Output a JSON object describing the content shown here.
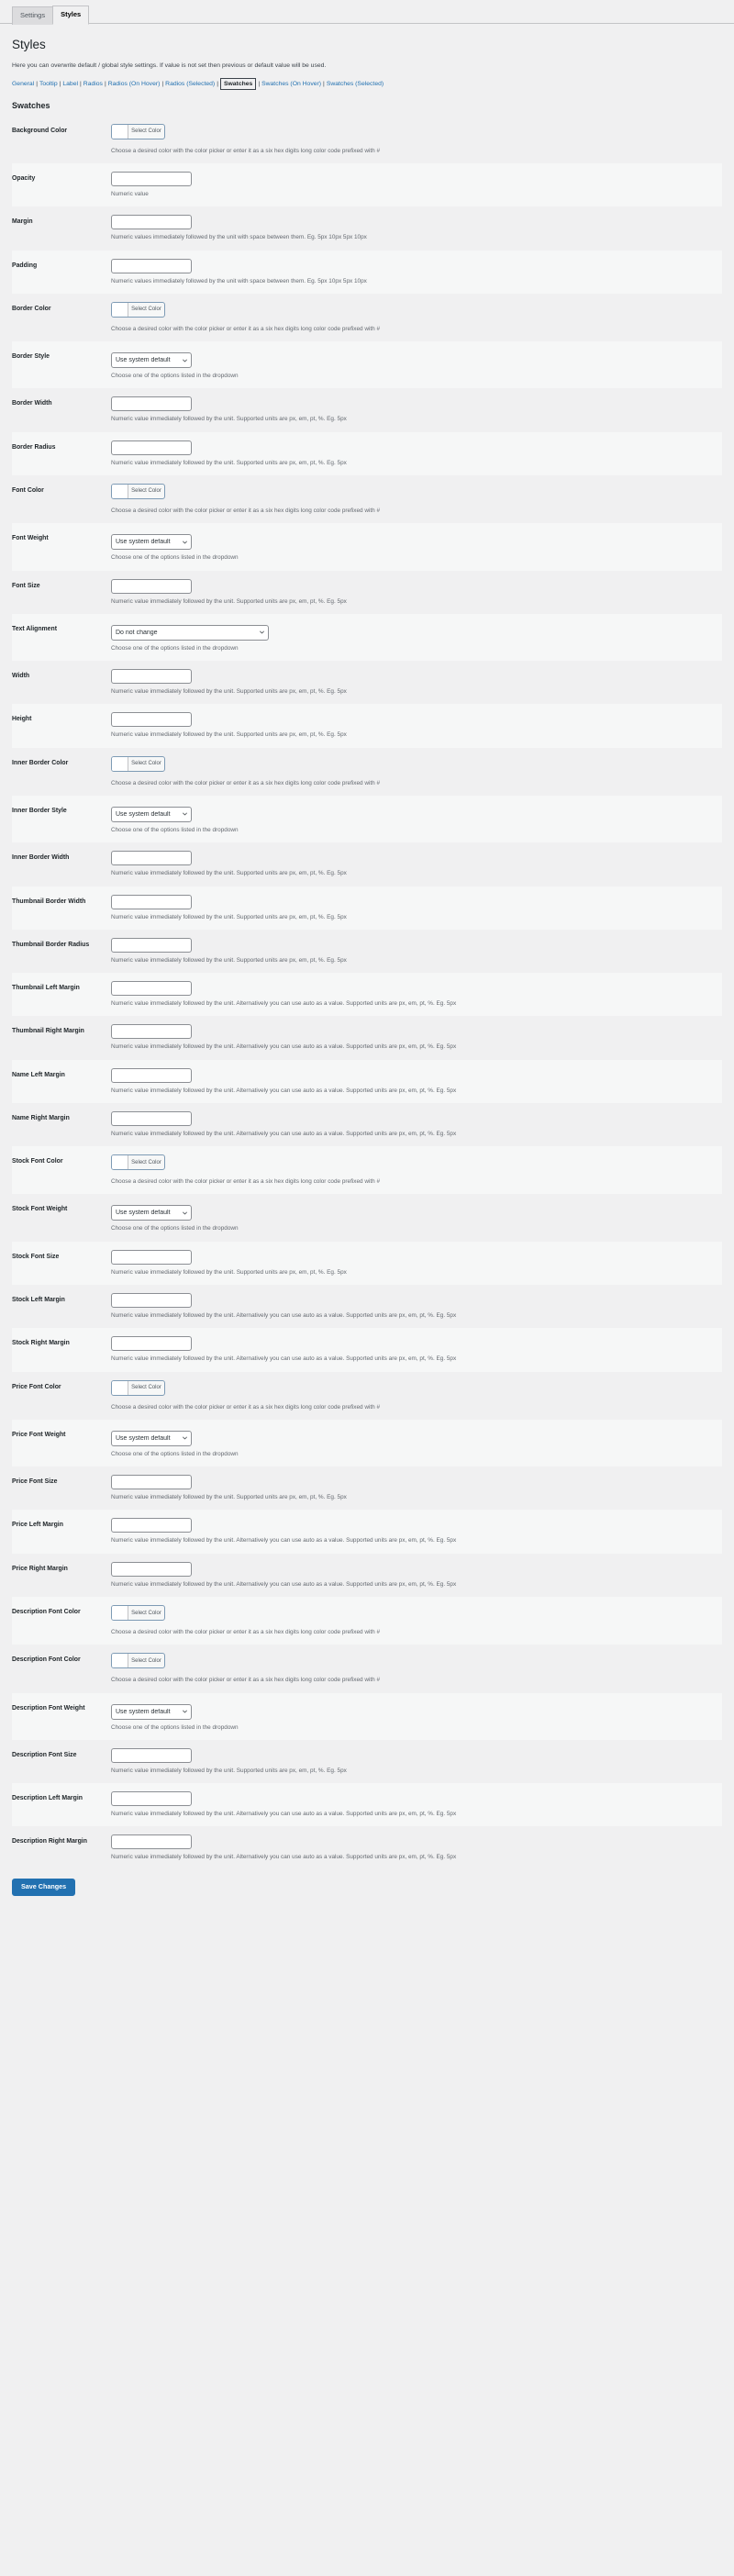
{
  "tabs": [
    {
      "label": "Settings",
      "active": false
    },
    {
      "label": "Styles",
      "active": true
    }
  ],
  "page": {
    "title": "Styles",
    "intro": "Here you can overwrite default / global style settings. If value is not set then previous or default value will be used.",
    "section_title": "Swatches"
  },
  "subnav": {
    "items": [
      {
        "label": "General",
        "current": false
      },
      {
        "label": "Tooltip",
        "current": false
      },
      {
        "label": "Label",
        "current": false
      },
      {
        "label": "Radios",
        "current": false
      },
      {
        "label": "Radios (On Hover)",
        "current": false
      },
      {
        "label": "Radios (Selected)",
        "current": false
      },
      {
        "label": "Swatches",
        "current": true
      },
      {
        "label": "Swatches (On Hover)",
        "current": false
      },
      {
        "label": "Swatches (Selected)",
        "current": false
      }
    ],
    "separator": "|"
  },
  "controls": {
    "select_color_label": "Select Color",
    "select_default_value": "Use system default",
    "text_alignment_value": "Do not change",
    "input_value": ""
  },
  "help_texts": {
    "color": "Choose a desired color with the color picker or enter it as a six hex digits long color code prefixed with #",
    "numeric": "Numeric value",
    "unit_multi": "Numeric values immediately followed by the unit with space between them. Eg. 5px 10px 5px 10px",
    "unit_single": "Numeric value immediately followed by the unit. Supported units are px, em, pt, %. Eg. 5px",
    "dropdown": "Choose one of the options listed in the dropdown",
    "unit_auto": "Numeric value immediately followed by the unit. Alternatively you can use auto as a value. Supported units are px, em, pt, %. Eg. 5px"
  },
  "rows": [
    {
      "label": "Background Color",
      "type": "color",
      "help": "color"
    },
    {
      "label": "Opacity",
      "type": "text",
      "help": "numeric"
    },
    {
      "label": "Margin",
      "type": "text",
      "help": "unit_multi"
    },
    {
      "label": "Padding",
      "type": "text",
      "help": "unit_multi"
    },
    {
      "label": "Border Color",
      "type": "color",
      "help": "color"
    },
    {
      "label": "Border Style",
      "type": "select",
      "help": "dropdown"
    },
    {
      "label": "Border Width",
      "type": "text",
      "help": "unit_single"
    },
    {
      "label": "Border Radius",
      "type": "text",
      "help": "unit_single"
    },
    {
      "label": "Font Color",
      "type": "color",
      "help": "color"
    },
    {
      "label": "Font Weight",
      "type": "select",
      "help": "dropdown"
    },
    {
      "label": "Font Size",
      "type": "text",
      "help": "unit_single"
    },
    {
      "label": "Text Alignment",
      "type": "select-wide",
      "help": "dropdown"
    },
    {
      "label": "Width",
      "type": "text",
      "help": "unit_single"
    },
    {
      "label": "Height",
      "type": "text",
      "help": "unit_single"
    },
    {
      "label": "Inner Border Color",
      "type": "color",
      "help": "color"
    },
    {
      "label": "Inner Border Style",
      "type": "select",
      "help": "dropdown"
    },
    {
      "label": "Inner Border Width",
      "type": "text",
      "help": "unit_single"
    },
    {
      "label": "Thumbnail Border Width",
      "type": "text",
      "help": "unit_single"
    },
    {
      "label": "Thumbnail Border Radius",
      "type": "text",
      "help": "unit_single"
    },
    {
      "label": "Thumbnail Left Margin",
      "type": "text",
      "help": "unit_auto"
    },
    {
      "label": "Thumbnail Right Margin",
      "type": "text",
      "help": "unit_auto"
    },
    {
      "label": "Name Left Margin",
      "type": "text",
      "help": "unit_auto"
    },
    {
      "label": "Name Right Margin",
      "type": "text",
      "help": "unit_auto"
    },
    {
      "label": "Stock Font Color",
      "type": "color",
      "help": "color"
    },
    {
      "label": "Stock Font Weight",
      "type": "select",
      "help": "dropdown"
    },
    {
      "label": "Stock Font Size",
      "type": "text",
      "help": "unit_single"
    },
    {
      "label": "Stock Left Margin",
      "type": "text",
      "help": "unit_auto"
    },
    {
      "label": "Stock Right Margin",
      "type": "text",
      "help": "unit_auto"
    },
    {
      "label": "Price Font Color",
      "type": "color",
      "help": "color"
    },
    {
      "label": "Price Font Weight",
      "type": "select",
      "help": "dropdown"
    },
    {
      "label": "Price Font Size",
      "type": "text",
      "help": "unit_single"
    },
    {
      "label": "Price Left Margin",
      "type": "text",
      "help": "unit_auto"
    },
    {
      "label": "Price Right Margin",
      "type": "text",
      "help": "unit_auto"
    },
    {
      "label": "Description Font Color",
      "type": "color",
      "help": "color"
    },
    {
      "label": "Description Font Color",
      "type": "color",
      "help": "color"
    },
    {
      "label": "Description Font Weight",
      "type": "select",
      "help": "dropdown"
    },
    {
      "label": "Description Font Size",
      "type": "text",
      "help": "unit_single"
    },
    {
      "label": "Description Left Margin",
      "type": "text",
      "help": "unit_auto"
    },
    {
      "label": "Description Right Margin",
      "type": "text",
      "help": "unit_auto"
    }
  ],
  "submit": {
    "label": "Save Changes"
  }
}
